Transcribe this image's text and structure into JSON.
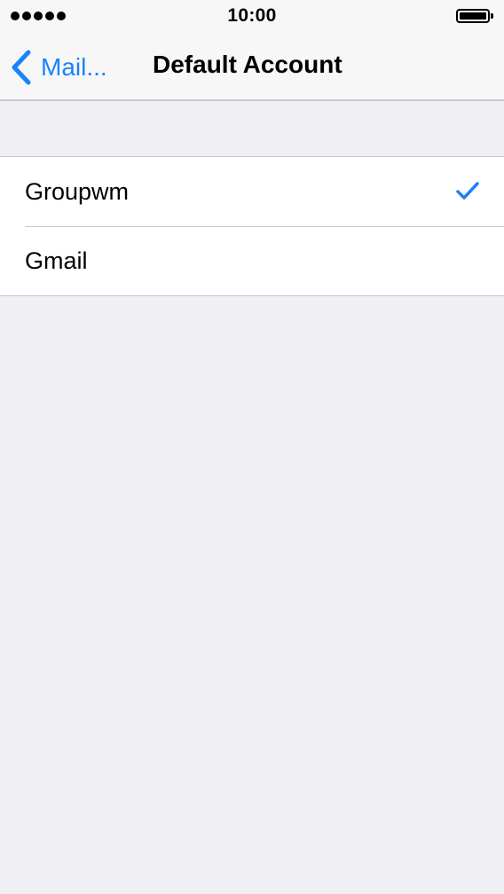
{
  "status_bar": {
    "time": "10:00",
    "signal_icon": "signal-dots-icon",
    "battery_icon": "battery-full-icon"
  },
  "nav": {
    "back_label": "Mail...",
    "back_icon": "chevron-left-icon",
    "title": "Default Account"
  },
  "accounts": {
    "items": [
      {
        "label": "Groupwm",
        "selected": true
      },
      {
        "label": "Gmail",
        "selected": false
      }
    ],
    "check_icon": "checkmark-icon"
  },
  "colors": {
    "accent": "#1a82fb",
    "background": "#efeff4",
    "bar_background": "#f7f7f7",
    "separator": "#c8c7cc"
  }
}
